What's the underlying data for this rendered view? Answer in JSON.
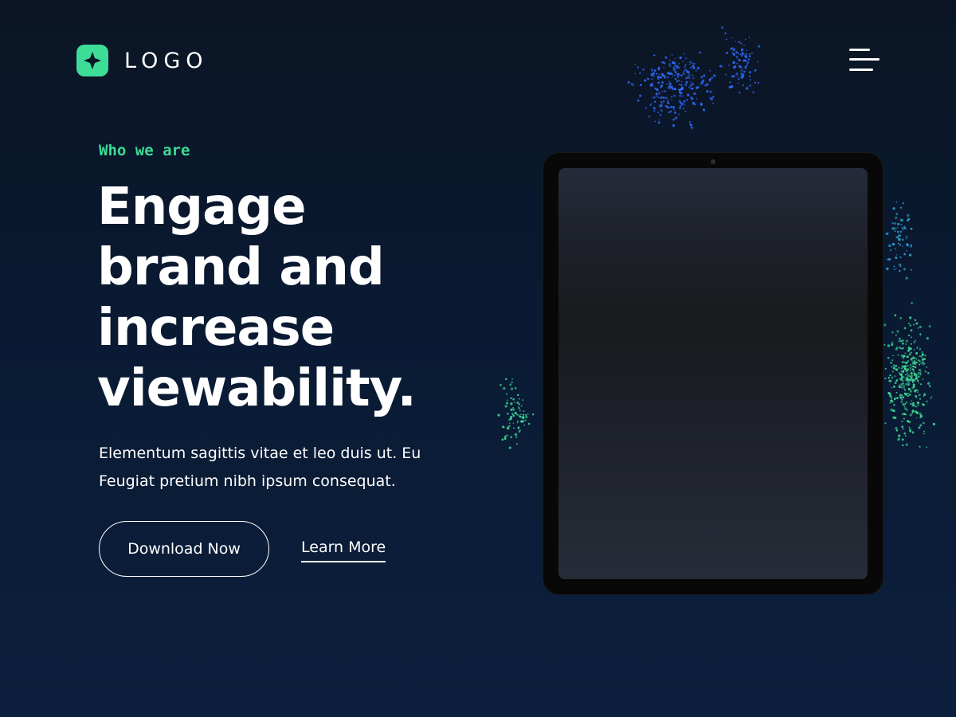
{
  "header": {
    "logo_text": "LOGO",
    "menu_icon": "hamburger-menu-icon"
  },
  "hero": {
    "eyebrow": "Who we are",
    "headline_lines": [
      "Engage",
      "brand and",
      "increase",
      "viewability."
    ],
    "subtext_lines": [
      "Elementum sagittis vitae et leo duis ut. Eu",
      "Feugiat pretium nibh ipsum consequat."
    ],
    "primary_button": "Download Now",
    "secondary_link": "Learn More"
  },
  "device": {
    "type": "tablet"
  },
  "colors": {
    "accent": "#3ddc97",
    "background_top": "#0b1524",
    "background_bottom": "#0c1f3c",
    "text": "#ffffff",
    "particles_blue": "#2f6bff",
    "particles_green": "#3ddc97"
  }
}
